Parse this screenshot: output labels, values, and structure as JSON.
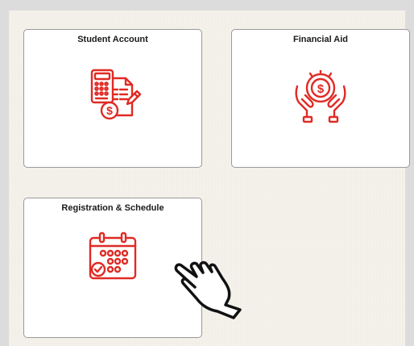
{
  "tiles": {
    "student_account": {
      "title": "Student Account",
      "icon": "billing-calculator-icon"
    },
    "financial_aid": {
      "title": "Financial Aid",
      "icon": "hands-coin-icon"
    },
    "registration": {
      "title": "Registration & Schedule",
      "icon": "calendar-check-icon"
    }
  },
  "cursor": {
    "icon": "pointing-hand-icon"
  },
  "colors": {
    "accent": "#e02a24",
    "tile_border": "#9a9a9a",
    "background": "#f5f2ec"
  }
}
